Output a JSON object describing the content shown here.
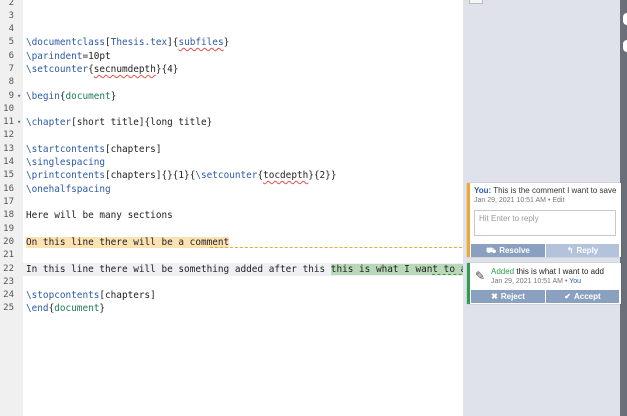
{
  "editor": {
    "lines": [
      {
        "n": "2",
        "t": ""
      },
      {
        "n": "3",
        "t": ""
      },
      {
        "n": "4",
        "t": ""
      },
      {
        "n": "5",
        "t": "\\documentclass[Thesis.tex]{subfiles}"
      },
      {
        "n": "6",
        "t": "\\parindent=10pt"
      },
      {
        "n": "7",
        "t": "\\setcounter{secnumdepth}{4}"
      },
      {
        "n": "8",
        "t": ""
      },
      {
        "n": "9",
        "t": "\\begin{document}"
      },
      {
        "n": "10",
        "t": ""
      },
      {
        "n": "11",
        "t": "\\chapter[short title]{long title}"
      },
      {
        "n": "12",
        "t": ""
      },
      {
        "n": "13",
        "t": "\\startcontents[chapters]"
      },
      {
        "n": "14",
        "t": "\\singlespacing"
      },
      {
        "n": "15",
        "t": "\\printcontents[chapters]{}{1}{\\setcounter{tocdepth}{2}}"
      },
      {
        "n": "16",
        "t": "\\onehalfspacing"
      },
      {
        "n": "17",
        "t": ""
      },
      {
        "n": "18",
        "t": "Here will be many sections"
      },
      {
        "n": "19",
        "t": ""
      },
      {
        "n": "20",
        "t": "On this line there will be a comment"
      },
      {
        "n": "21",
        "t": ""
      },
      {
        "n": "22",
        "t": "In this line there will be something added after this this is what I want to add"
      },
      {
        "n": "23",
        "t": ""
      },
      {
        "n": "24",
        "t": "\\stopcontents[chapters]"
      },
      {
        "n": "25",
        "t": "\\end{document}"
      }
    ]
  },
  "review": {
    "comment": {
      "author": "You:",
      "text": "This is the comment I want to save",
      "meta": "Jan 29, 2021 10:51 AM",
      "edit": "Edit",
      "reply_placeholder": "Hit Enter to reply",
      "resolve_label": "Resolve",
      "reply_label": "Reply"
    },
    "change": {
      "action": "Added",
      "text": "this is what I want to add",
      "meta": "Jan 29, 2021 10:51 AM",
      "author": "You",
      "reject_label": "Reject",
      "accept_label": "Accept"
    }
  },
  "colors": {
    "comment_accent": "#f0a830",
    "change_accent": "#2e9e4e",
    "button_blue": "#8aa0c0",
    "button_blue_light": "#b3c3dc"
  },
  "icons": [
    "chevron-down-icon",
    "pencil-icon",
    "resolve-icon",
    "reply-icon",
    "reject-icon",
    "accept-icon"
  ]
}
